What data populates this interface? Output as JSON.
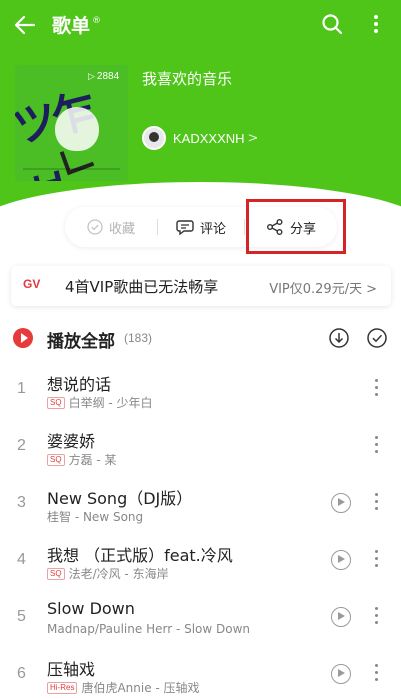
{
  "header": {
    "title": "歌单",
    "title_mark": "®"
  },
  "playlist": {
    "name": "我喜欢的音乐",
    "play_count": "2884",
    "owner_name": "KADXXXNH",
    "owner_chevron": ">"
  },
  "actions": {
    "favorite": "收藏",
    "comment": "评论",
    "share": "分享"
  },
  "vip_banner": {
    "logo": "GV",
    "message": "4首VIP歌曲已无法畅享",
    "offer": "VIP仅0.29元/天",
    "chevron": ">"
  },
  "play_all": {
    "label": "播放全部",
    "count": "(183)"
  },
  "songs": [
    {
      "index": "1",
      "title": "想说的话",
      "badge": "SQ",
      "artist_album": "白举纲 - 少年白",
      "has_mv": false
    },
    {
      "index": "2",
      "title": "婆婆娇",
      "badge": "SQ",
      "artist_album": "方磊 - 某",
      "has_mv": false
    },
    {
      "index": "3",
      "title": "New Song（DJ版）",
      "badge": "",
      "artist_album": "桂智 - New Song",
      "has_mv": true
    },
    {
      "index": "4",
      "title": "我想 （正式版）feat.冷风",
      "badge": "SQ",
      "artist_album": "法老/冷风 - 东海岸",
      "has_mv": true
    },
    {
      "index": "5",
      "title": "Slow Down",
      "badge": "",
      "artist_album": "Madnap/Pauline Herr - Slow Down",
      "has_mv": true
    },
    {
      "index": "6",
      "title": "压轴戏",
      "badge": "Hi-Res",
      "artist_album": "唐伯虎Annie - 压轴戏",
      "has_mv": true
    }
  ],
  "colors": {
    "brand_green": "#4fc51a",
    "accent_red": "#e73a3a",
    "highlight_box": "#d42525"
  }
}
